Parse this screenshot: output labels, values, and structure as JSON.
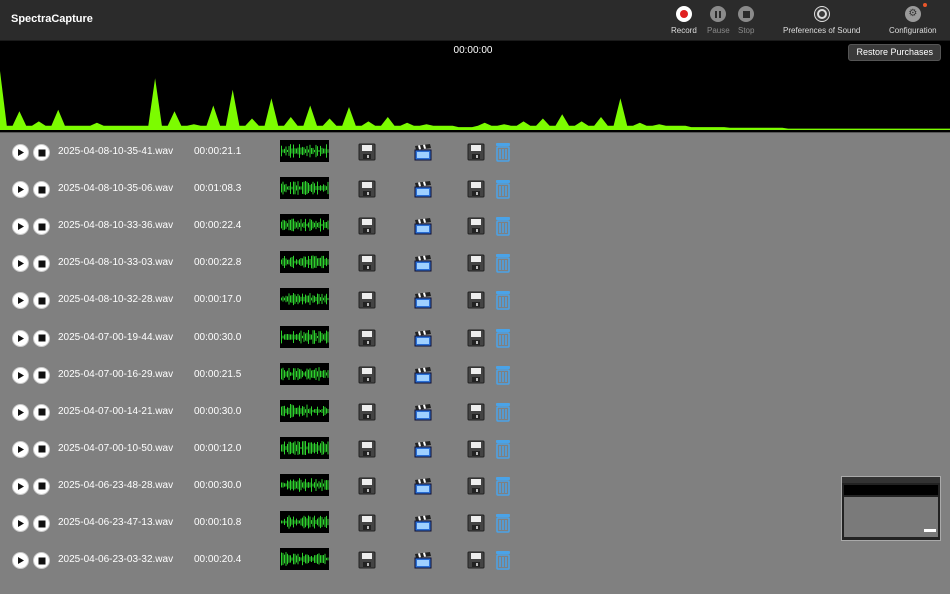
{
  "app": {
    "title": "SpectraCapture"
  },
  "toolbar": {
    "record_label": "Record",
    "pause_label": "Pause",
    "stop_label": "Stop",
    "sound_prefs_label": "Preferences of Sound",
    "config_label": "Configuration"
  },
  "colors": {
    "record": "#e02020",
    "waveform": "#7cfc00",
    "disabled_text": "#8a8a8a",
    "trash": "#4aa3e8"
  },
  "monitor": {
    "timer": "00:00:00",
    "restore_label": "Restore Purchases",
    "levels": [
      0.82,
      0.26,
      0.12,
      0.28,
      0.06,
      0.1,
      0.06,
      0.06,
      0.72,
      0.26,
      0.08,
      0.34,
      0.56,
      0.16,
      0.44,
      0.18,
      0.34,
      0.16,
      0.32,
      0.12,
      0.18,
      0.1,
      0.08,
      0.06,
      0.04,
      0.1,
      0.08,
      0.12,
      0.16,
      0.22,
      0.12,
      0.18,
      0.44,
      0.1,
      0.08,
      0.06,
      0.04,
      0.04,
      0.03,
      0.03,
      0.03,
      0.02,
      0.02,
      0.02,
      0.02,
      0.02,
      0.02,
      0.02,
      0.02,
      0.02
    ]
  },
  "recordings": [
    {
      "file": "2025-04-08-10-35-41.wav",
      "duration": "00:00:21.1"
    },
    {
      "file": "2025-04-08-10-35-06.wav",
      "duration": "00:01:08.3"
    },
    {
      "file": "2025-04-08-10-33-36.wav",
      "duration": "00:00:22.4"
    },
    {
      "file": "2025-04-08-10-33-03.wav",
      "duration": "00:00:22.8"
    },
    {
      "file": "2025-04-08-10-32-28.wav",
      "duration": "00:00:17.0"
    },
    {
      "file": "2025-04-07-00-19-44.wav",
      "duration": "00:00:30.0"
    },
    {
      "file": "2025-04-07-00-16-29.wav",
      "duration": "00:00:21.5"
    },
    {
      "file": "2025-04-07-00-14-21.wav",
      "duration": "00:00:30.0"
    },
    {
      "file": "2025-04-07-00-10-50.wav",
      "duration": "00:00:12.0"
    },
    {
      "file": "2025-04-06-23-48-28.wav",
      "duration": "00:00:30.0"
    },
    {
      "file": "2025-04-06-23-47-13.wav",
      "duration": "00:00:10.8"
    },
    {
      "file": "2025-04-06-23-03-32.wav",
      "duration": "00:00:20.4"
    }
  ]
}
